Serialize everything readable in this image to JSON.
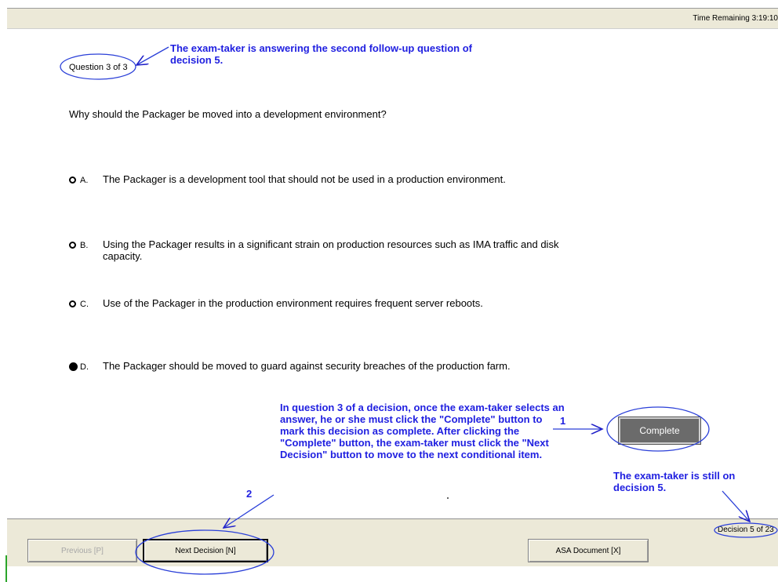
{
  "header": {
    "time_remaining": "Time Remaining 3:19:10"
  },
  "question": {
    "counter": "Question 3 of 3",
    "text": "Why should the Packager be moved into a development environment?",
    "options": [
      {
        "letter": "A.",
        "text": "The Packager is a development tool that should not be used in a production environment.",
        "selected": false
      },
      {
        "letter": "B.",
        "text": "Using the Packager results in a significant strain on production resources such as IMA traffic and disk capacity.",
        "selected": false
      },
      {
        "letter": "C.",
        "text": "Use of the Packager in the production environment requires frequent server reboots.",
        "selected": false
      },
      {
        "letter": "D.",
        "text": "The Packager should be moved to guard against security breaches of the production farm.",
        "selected": true
      }
    ]
  },
  "buttons": {
    "complete": "Complete",
    "previous": "Previous [P]",
    "next_decision": "Next Decision [N]",
    "asa_document": "ASA Document [X]"
  },
  "footer": {
    "decision_counter": "Decision 5 of 23"
  },
  "annotations": {
    "top_note": "The exam-taker is answering the second follow-up question of decision 5.",
    "middle_note": "In question 3 of a decision, once the exam-taker selects an answer, he or she must click the \"Complete\" button to mark this decision as complete. After clicking the \"Complete\" button, the exam-taker must click the \"Next Decision\" button to move to the next conditional item.",
    "step_1": "1",
    "step_2": "2",
    "right_note": "The exam-taker is still on decision 5."
  },
  "colors": {
    "annotation": "#1f1fe0",
    "toolbar_bg": "#ece9d8",
    "complete_bg": "#6b6b6b"
  }
}
